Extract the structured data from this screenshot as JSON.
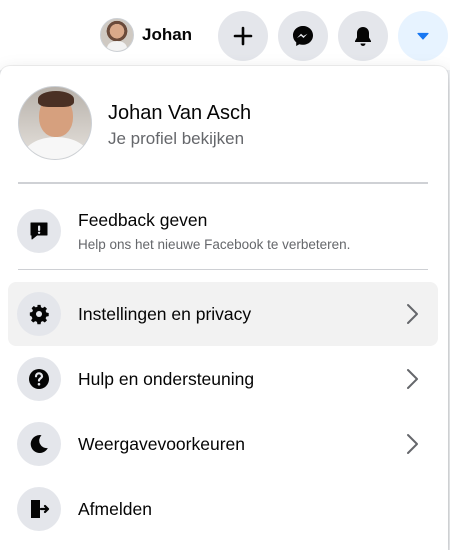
{
  "topbar": {
    "user_name": "Johan",
    "buttons": [
      {
        "name": "create",
        "icon": "plus-icon"
      },
      {
        "name": "messenger",
        "icon": "messenger-icon"
      },
      {
        "name": "notifications",
        "icon": "bell-icon"
      },
      {
        "name": "account",
        "icon": "caret-down-icon",
        "active": true
      }
    ]
  },
  "menu": {
    "profile": {
      "name": "Johan Van Asch",
      "subtitle": "Je profiel bekijken"
    },
    "feedback": {
      "label": "Feedback geven",
      "sub": "Help ons het nieuwe Facebook te verbeteren.",
      "icon": "feedback-exclamation-icon"
    },
    "items": [
      {
        "label": "Instellingen en privacy",
        "icon": "gear-icon",
        "has_chevron": true,
        "highlighted": true
      },
      {
        "label": "Hulp en ondersteuning",
        "icon": "question-icon",
        "has_chevron": true
      },
      {
        "label": "Weergavevoorkeuren",
        "icon": "moon-icon",
        "has_chevron": true
      },
      {
        "label": "Afmelden",
        "icon": "logout-door-icon",
        "has_chevron": false
      }
    ]
  },
  "colors": {
    "accent": "#1877f2",
    "icon_bg": "#e4e6eb",
    "active_btn_bg": "#e7f3ff",
    "secondary_text": "#65676b",
    "hover_bg": "#f2f2f2"
  }
}
